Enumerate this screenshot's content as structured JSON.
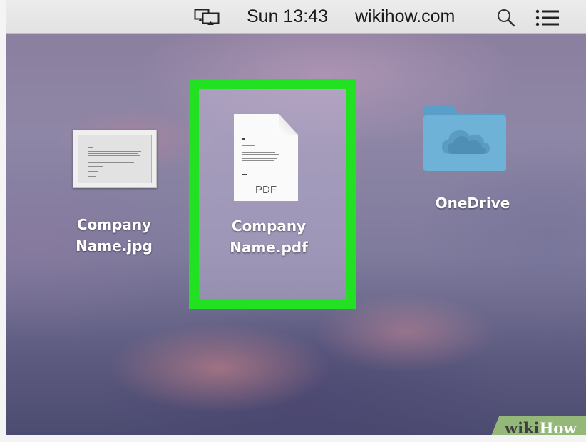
{
  "menubar": {
    "display_icon": "display-mirroring-icon",
    "clock": "Sun 13:43",
    "site": "wikihow.com",
    "search_icon": "spotlight-search-icon",
    "notification_icon": "notification-center-icon"
  },
  "desktop": {
    "items": [
      {
        "name": "Company\nName.jpg",
        "icon": "jpg-image-file-icon",
        "selected": false
      },
      {
        "name": "Company\nName.pdf",
        "icon": "pdf-document-icon",
        "badge": "PDF",
        "selected": true
      },
      {
        "name": "OneDrive",
        "icon": "onedrive-folder-icon",
        "selected": false
      }
    ],
    "highlight_color": "#22e022"
  },
  "watermark": {
    "part1": "wiki",
    "part2": "How"
  }
}
